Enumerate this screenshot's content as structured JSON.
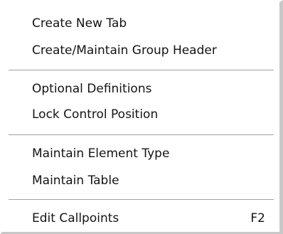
{
  "menu": {
    "items": [
      {
        "label": "Create New Tab",
        "shortcut": ""
      },
      {
        "label": "Create/Maintain Group Header",
        "shortcut": ""
      },
      {
        "label": "Optional Definitions",
        "shortcut": ""
      },
      {
        "label": "Lock Control Position",
        "shortcut": ""
      },
      {
        "label": "Maintain Element Type",
        "shortcut": ""
      },
      {
        "label": "Maintain Table",
        "shortcut": ""
      },
      {
        "label": "Edit Callpoints",
        "shortcut": "F2"
      }
    ]
  }
}
